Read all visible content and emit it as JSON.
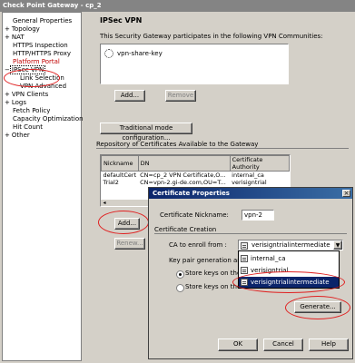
{
  "window": {
    "title": "Check Point Gateway - cp_2"
  },
  "tree": [
    {
      "label": "General Properties",
      "expander": ""
    },
    {
      "label": "Topology",
      "expander": "+"
    },
    {
      "label": "NAT",
      "expander": "+"
    },
    {
      "label": "HTTPS Inspection",
      "expander": ""
    },
    {
      "label": "HTTP/HTTPS Proxy",
      "expander": ""
    },
    {
      "label": "Platform Portal",
      "expander": ""
    },
    {
      "label": "IPSec VPN",
      "expander": "−"
    },
    {
      "label": "Link Selection",
      "expander": ""
    },
    {
      "label": "VPN Advanced",
      "expander": ""
    },
    {
      "label": "VPN Clients",
      "expander": "+"
    },
    {
      "label": "Logs",
      "expander": "+"
    },
    {
      "label": "Fetch Policy",
      "expander": ""
    },
    {
      "label": "Capacity Optimization",
      "expander": ""
    },
    {
      "label": "Hit Count",
      "expander": ""
    },
    {
      "label": "Other",
      "expander": "+"
    }
  ],
  "main": {
    "heading": "IPSec VPN",
    "participates_text": "This Security Gateway participates in the following VPN Communities:",
    "community": "vpn-share-key",
    "add_label": "Add...",
    "remove_label": "Remove",
    "traditional_label": "Traditional mode configuration...",
    "repo_label": "Repository of Certificates Available to the Gateway",
    "columns": [
      "Nickname",
      "DN",
      "Certificate Authority"
    ],
    "rows": [
      [
        "defaultCert",
        "CN=cp_2 VPN Certificate,O...",
        "internal_ca"
      ],
      [
        "Trial2",
        "CN=vpn-2.gi-de.com,OU=T...",
        "verisigntrial"
      ]
    ],
    "cert_add_label": "Add...",
    "renew_label": "Renew..."
  },
  "dialog": {
    "title": "Certificate Properties",
    "close_glyph": "×",
    "nickname_label": "Certificate Nickname:",
    "nickname_value": "vpn-2",
    "creation_label": "Certificate Creation",
    "ca_label": "CA to enroll from :",
    "ca_value": "verisigntrialintermediate",
    "keypair_label": "Key pair generation and",
    "radio1_label": "Store keys on the",
    "radio2_label": "Store keys on the Module",
    "dropdown_options": [
      "internal_ca",
      "verisigntrial",
      "verisigntrialintermediate"
    ],
    "generate_label": "Generate...",
    "ok_label": "OK",
    "cancel_label": "Cancel",
    "help_label": "Help"
  },
  "annotation_color": "#e02020"
}
